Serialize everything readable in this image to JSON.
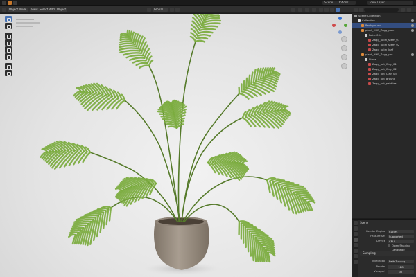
{
  "topbar": {
    "scene_name": "Scene",
    "view_layer": "View Layer"
  },
  "viewport": {
    "mode_label": "Object Mode",
    "menus": [
      "View",
      "Select",
      "Add",
      "Object"
    ],
    "transform_orientation": "Global",
    "options_label": "Options"
  },
  "outliner": {
    "rows": [
      {
        "label": "Scene Collection",
        "depth": 0,
        "selected": false,
        "color": "#9a9a9a"
      },
      {
        "label": "Collection",
        "depth": 1,
        "selected": false,
        "color": "#e0e0e0"
      },
      {
        "label": "Background",
        "depth": 2,
        "selected": true,
        "color": "#e08b3a"
      },
      {
        "label": "plant_HHE_Zagg_palm",
        "depth": 2,
        "selected": false,
        "color": "#e08b3a"
      },
      {
        "label": "Palms004",
        "depth": 3,
        "selected": false,
        "color": "#d0d0d0"
      },
      {
        "label": "Zagg_palm_stem_01",
        "depth": 4,
        "selected": false,
        "color": "#c74a4a"
      },
      {
        "label": "Zagg_palm_stem_02",
        "depth": 4,
        "selected": false,
        "color": "#c74a4a"
      },
      {
        "label": "Zagg_palm_leaf",
        "depth": 4,
        "selected": false,
        "color": "#c74a4a"
      },
      {
        "label": "plant_HHE_Zagg_pot",
        "depth": 2,
        "selected": false,
        "color": "#e08b3a"
      },
      {
        "label": "Stone",
        "depth": 3,
        "selected": false,
        "color": "#d0d0d0"
      },
      {
        "label": "Zagg_pot_Clay_01",
        "depth": 4,
        "selected": false,
        "color": "#c74a4a"
      },
      {
        "label": "Zagg_pot_Clay_02",
        "depth": 4,
        "selected": false,
        "color": "#c74a4a"
      },
      {
        "label": "Zagg_pot_Clay_03",
        "depth": 4,
        "selected": false,
        "color": "#c74a4a"
      },
      {
        "label": "Zagg_pot_ground",
        "depth": 4,
        "selected": false,
        "color": "#c74a4a"
      },
      {
        "label": "Zagg_pot_pebbles",
        "depth": 4,
        "selected": false,
        "color": "#c74a4a"
      }
    ]
  },
  "properties": {
    "title": "Scene",
    "render_engine_label": "Render Engine",
    "render_engine_value": "Cycles",
    "feature_set_label": "Feature Set",
    "feature_set_value": "Supported",
    "device_label": "Device",
    "device_value": "CPU",
    "osl_label": "Open Shading Language",
    "sampling_label": "Sampling",
    "integrator_label": "Integrator",
    "integrator_value": "Path Tracing",
    "render_label": "Render",
    "render_value": "128",
    "viewport_label": "Viewport",
    "viewport_value": "32"
  },
  "colors": {
    "accent": "#4772b3",
    "viewport_bg": "#e6e6e6",
    "leaf": "#7bab3e",
    "pot": "#9a8e80"
  }
}
